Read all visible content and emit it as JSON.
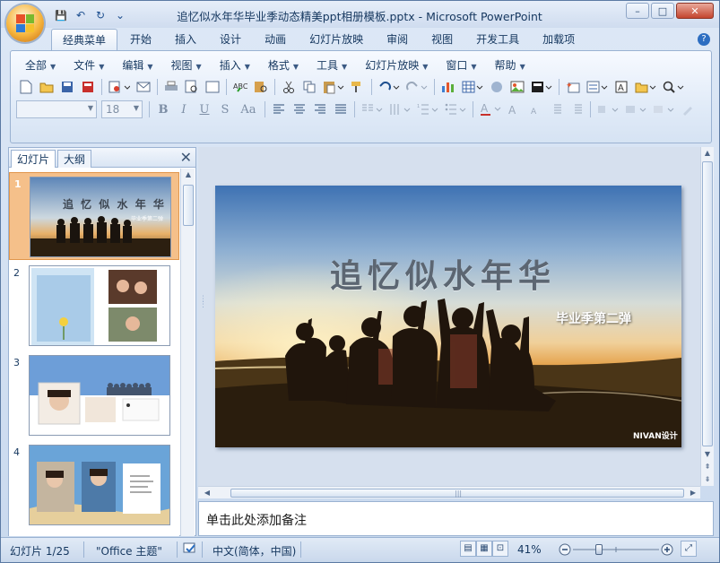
{
  "window": {
    "title": "追忆似水年华毕业季动态精美ppt相册模板.pptx - Microsoft PowerPoint",
    "minimize": "–",
    "maximize": "□",
    "close": "✕"
  },
  "qat": {
    "save": "💾",
    "undo": "↶",
    "redo": "↻",
    "customize": "⌄"
  },
  "ribbon_tabs": [
    "经典菜单",
    "开始",
    "插入",
    "设计",
    "动画",
    "幻灯片放映",
    "审阅",
    "视图",
    "开发工具",
    "加载项"
  ],
  "ribbon_active_tab": "经典菜单",
  "menu": [
    "全部",
    "文件",
    "编辑",
    "视图",
    "插入",
    "格式",
    "工具",
    "幻灯片放映",
    "窗口",
    "帮助"
  ],
  "font": {
    "name": "",
    "size": "18"
  },
  "format_buttons": [
    "B",
    "I",
    "U",
    "S",
    "Aa"
  ],
  "panel": {
    "tab_slides": "幻灯片",
    "tab_outline": "大纲",
    "close": "✕"
  },
  "thumbnails": [
    {
      "num": "1",
      "title": "追 忆 似 水 年 华",
      "subtitle": "毕业季第二弹",
      "selected": true
    },
    {
      "num": "2",
      "title": "",
      "subtitle": "",
      "selected": false
    },
    {
      "num": "3",
      "title": "",
      "subtitle": "",
      "selected": false
    },
    {
      "num": "4",
      "title": "",
      "subtitle": "",
      "selected": false
    }
  ],
  "slide": {
    "title": "追忆似水年华",
    "subtitle": "毕业季第二弹",
    "brand": "NIVAN设计"
  },
  "notes_placeholder": "单击此处添加备注",
  "status": {
    "slide_counter": "幻灯片 1/25",
    "theme": "\"Office 主题\"",
    "language": "中文(简体，中国)",
    "zoom": "41%",
    "zoom_level": 0.41
  },
  "colors": {
    "accent": "#1e395b",
    "selected_thumb": "#f5c08a",
    "ribbon_bg": "#dde8f6"
  }
}
